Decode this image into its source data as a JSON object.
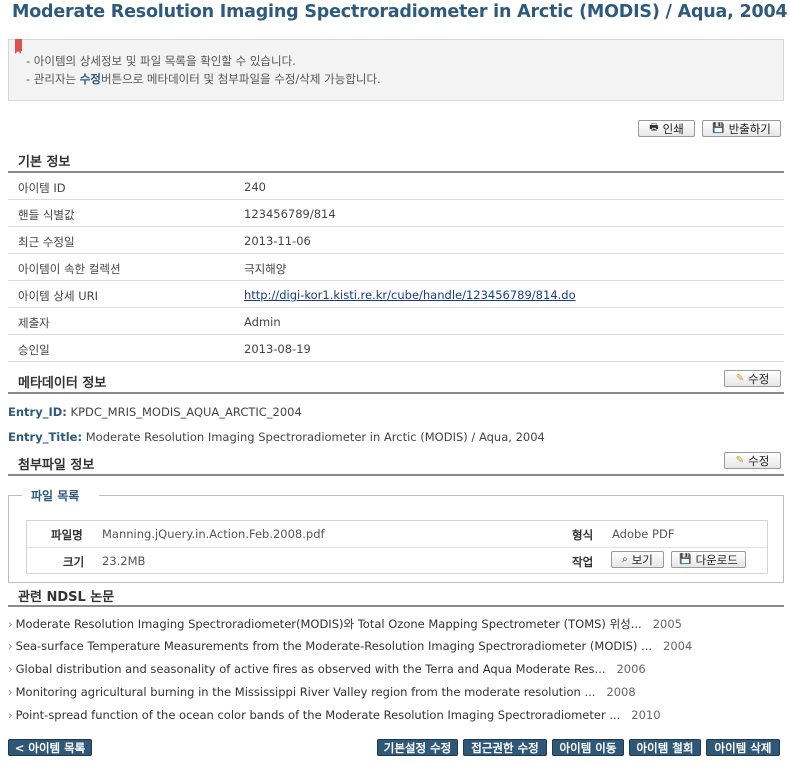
{
  "page_title": "Moderate Resolution Imaging Spectroradiometer in Arctic (MODIS) / Aqua, 2004",
  "notice": {
    "line1": "- 아이템의 상세정보 및 파일 목록을 확인할 수 있습니다.",
    "line2_prefix": "- 관리자는 ",
    "line2_bold": "수정",
    "line2_suffix": "버튼으로 메타데이터 및 첨부파일을 수정/삭제 가능합니다."
  },
  "toolbar": {
    "print_label": "인쇄",
    "export_label": "반출하기"
  },
  "basic_info": {
    "title": "기본 정보",
    "rows": [
      {
        "label": "아이템 ID",
        "value": "240"
      },
      {
        "label": "핸들 식별값",
        "value": "123456789/814"
      },
      {
        "label": "최근 수정일",
        "value": "2013-11-06"
      },
      {
        "label": "아이템이 속한 컬렉션",
        "value": "극지해양"
      },
      {
        "label": "아이템 상세 URI",
        "value": "http://digi-kor1.kisti.re.kr/cube/handle/123456789/814.do"
      },
      {
        "label": "제출자",
        "value": "Admin"
      },
      {
        "label": "승인일",
        "value": "2013-08-19"
      }
    ]
  },
  "metadata": {
    "title": "메타데이터 정보",
    "edit_label": "수정",
    "entries": [
      {
        "key": "Entry_ID:",
        "value": "KPDC_MRIS_MODIS_AQUA_ARCTIC_2004"
      },
      {
        "key": "Entry_Title:",
        "value": "Moderate Resolution Imaging Spectroradiometer in Arctic (MODIS) / Aqua, 2004"
      }
    ]
  },
  "attachments": {
    "title": "첨부파일 정보",
    "edit_label": "수정",
    "legend": "파일 목록",
    "filename_header": "파일명",
    "filename": "Manning.jQuery.in.Action.Feb.2008.pdf",
    "format_header": "형식",
    "format": "Adobe PDF",
    "size_header": "크기",
    "size": "23.2MB",
    "action_header": "작업",
    "view_label": "보기",
    "download_label": "다운로드"
  },
  "ndsl": {
    "title": "관련 NDSL 논문",
    "items": [
      {
        "title": "Moderate Resolution Imaging Spectroradiometer(MODIS)와 Total Ozone Mapping Spectrometer (TOMS) 위성...",
        "year": "2005"
      },
      {
        "title": "Sea-surface Temperature Measurements from the Moderate-Resolution Imaging Spectroradiometer (MODIS) ...",
        "year": "2004"
      },
      {
        "title": "Global distribution and seasonality of active fires as observed with the Terra and Aqua Moderate Res...",
        "year": "2006"
      },
      {
        "title": "Monitoring agricultural burning in the Mississippi River Valley region from the moderate resolution ...",
        "year": "2008"
      },
      {
        "title": "Point-spread function of the ocean color bands of the Moderate Resolution Imaging Spectroradiometer ...",
        "year": "2010"
      }
    ]
  },
  "footer": {
    "back_label": "< 아이템 목록",
    "basic_edit_label": "기본설정 수정",
    "access_edit_label": "접근권한 수정",
    "move_label": "아이템 이동",
    "withdraw_label": "아이템 철회",
    "delete_label": "아이템 삭제"
  },
  "colors": {
    "title": "#2e5a7e",
    "dark_button": "#2f5878",
    "link": "#1a3c8c"
  }
}
